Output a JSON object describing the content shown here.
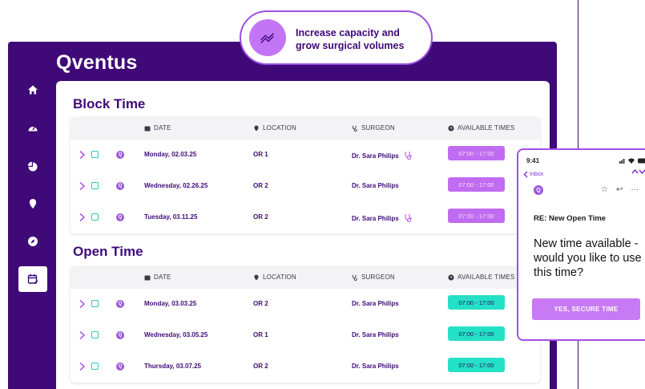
{
  "brand": "Qventus",
  "callout": {
    "text_line1": "Increase capacity and",
    "text_line2": "grow surgical volumes"
  },
  "sidebar": {
    "items": [
      "home-icon",
      "dashboard-icon",
      "pie-chart-icon",
      "location-pin-icon",
      "compass-icon",
      "calendar-edit-icon"
    ],
    "active": "calendar-edit-icon"
  },
  "columns": {
    "date": "DATE",
    "location": "LOCATION",
    "surgeon": "SURGEON",
    "times": "AVAILABLE TIMES"
  },
  "block_time": {
    "title": "Block Time",
    "rows": [
      {
        "date": "Monday, 02.03.25",
        "location": "OR 1",
        "surgeon": "Dr. Sara Philips",
        "times": "07:00 - 17:00"
      },
      {
        "date": "Wednesday, 02.26.25",
        "location": "OR 2",
        "surgeon": "Dr. Sara Philips",
        "times": "07:00 - 17:00"
      },
      {
        "date": "Tuesday, 03.11.25",
        "location": "OR 2",
        "surgeon": "Dr. Sara Philips",
        "times": "07:00 - 17:00"
      }
    ]
  },
  "open_time": {
    "title": "Open Time",
    "rows": [
      {
        "date": "Monday, 03.03.25",
        "location": "OR 2",
        "surgeon": "Dr. Sara Philips",
        "times": "07:00 - 17:00"
      },
      {
        "date": "Wednesday, 03.05.25",
        "location": "OR 1",
        "surgeon": "Dr. Sara Philips",
        "times": "07:00 - 17:00"
      },
      {
        "date": "Thursday, 03.07.25",
        "location": "OR 2",
        "surgeon": "Dr. Sara Philips",
        "times": "07:00 - 17:00"
      }
    ]
  },
  "phone": {
    "time": "9:41",
    "back": "Inbox",
    "avatar": "Q",
    "subject": "RE: New Open Time",
    "body": "New time available - would you like to use this time?",
    "cta": "YES, SECURE TIME"
  },
  "colors": {
    "brand_purple": "#3f0a78",
    "block_badge": "#c06cf0",
    "open_badge": "#24e0c7",
    "accent": "#9b4fe0"
  }
}
